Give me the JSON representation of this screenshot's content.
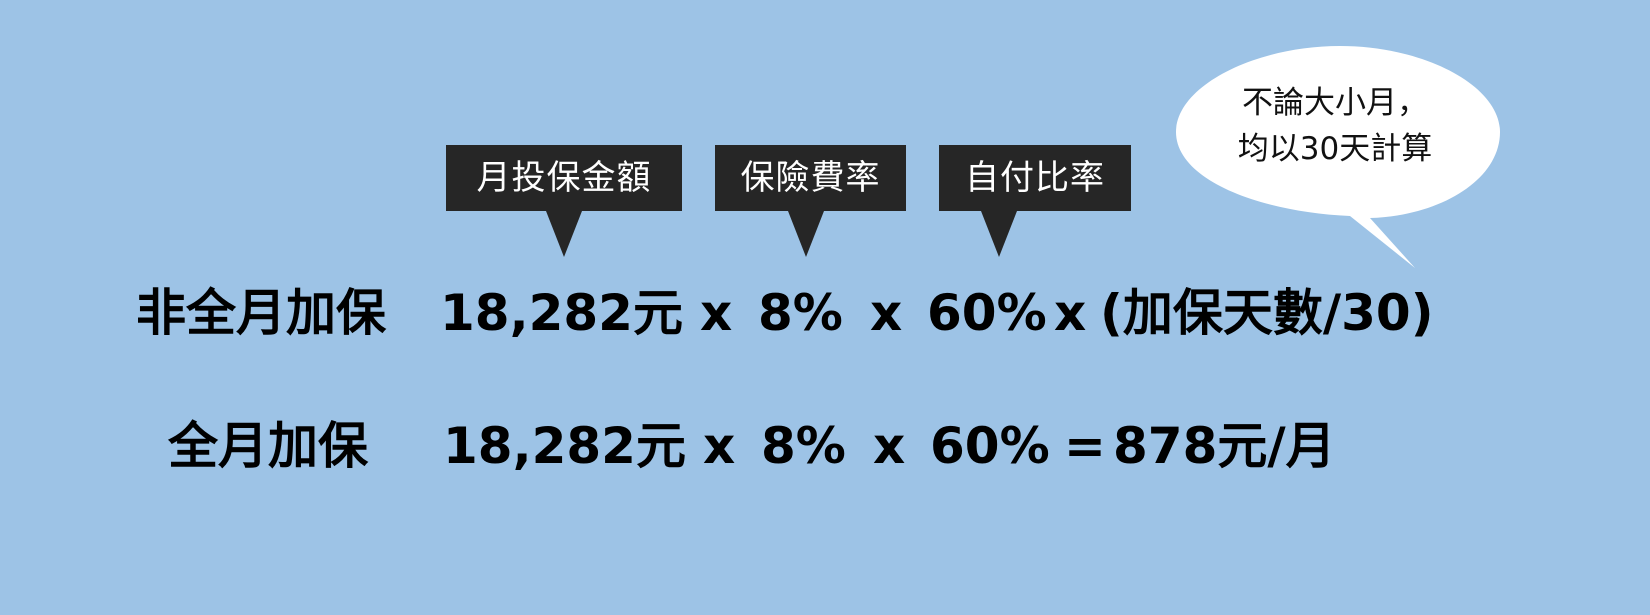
{
  "labels": {
    "monthly_insured_amount": "月投保金額",
    "insurance_rate": "保險費率",
    "self_pay_ratio": "自付比率"
  },
  "bubble": {
    "line1": "不論大小月，",
    "line2": "均以30天計算"
  },
  "partial_month": {
    "label": "非全月加保",
    "amount": "18,282元",
    "op1": "x",
    "rate": "8%",
    "op2": "x",
    "ratio": "60%",
    "op3": "x",
    "days_factor": "(加保天數/30)"
  },
  "full_month": {
    "label": "全月加保",
    "amount": "18,282元",
    "op1": "x",
    "rate": "8%",
    "op2": "x",
    "ratio": "60%",
    "equals": "=",
    "result": "878元/月"
  },
  "colors": {
    "background": "#9dc3e6",
    "tag_background": "#262626",
    "tag_text": "#ffffff",
    "bubble_fill": "#ffffff"
  }
}
